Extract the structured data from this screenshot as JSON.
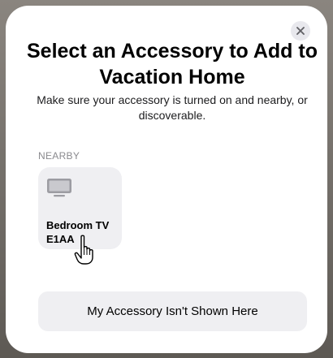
{
  "dialog": {
    "title": "Select an Accessory to Add to Vacation Home",
    "subtitle": "Make sure your accessory is turned on and nearby, or discoverable.",
    "close_icon": "close-icon"
  },
  "nearby": {
    "section_label": "NEARBY",
    "accessories": [
      {
        "name": "Bedroom TV E1AA",
        "icon": "tv-icon"
      }
    ]
  },
  "footer": {
    "not_shown_label": "My Accessory Isn't Shown Here"
  },
  "colors": {
    "tile_background": "#efeff2",
    "section_label": "#8a8a8e"
  }
}
